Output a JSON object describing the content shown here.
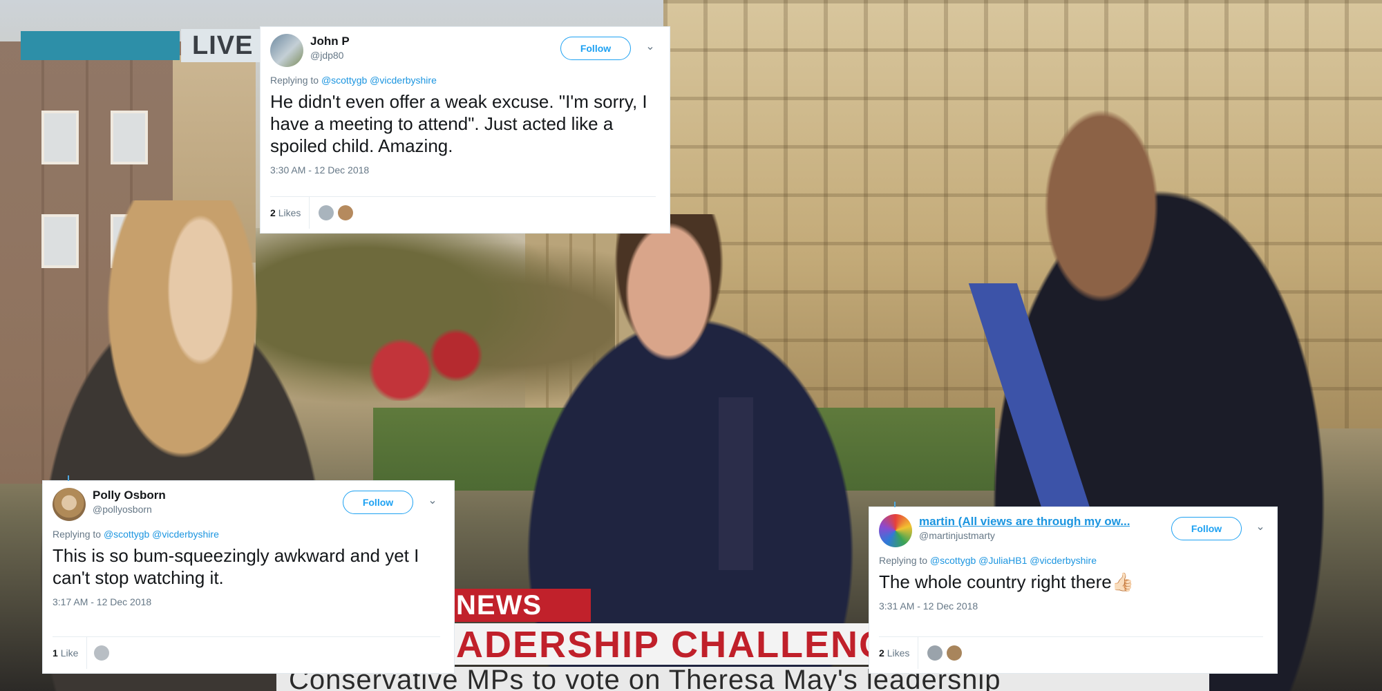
{
  "broadcast": {
    "live_label": "LIVE",
    "channel_label": "NEWS",
    "headline": "ADERSHIP CHALLENG",
    "ticker": "Conservative MPs to vote on Theresa May's leadership"
  },
  "tweets": [
    {
      "name": "John P",
      "handle": "@jdp80",
      "follow_label": "Follow",
      "caret": "⌄",
      "reply_prefix": "Replying to",
      "reply_to": "@scottygb @vicderbyshire",
      "text": "He didn't even offer a weak excuse. \"I'm sorry, I have a meeting to attend\". Just acted like a spoiled child. Amazing.",
      "time": "3:30 AM - 12 Dec 2018",
      "likes_count": "2",
      "likes_label": "Likes"
    },
    {
      "name": "Polly Osborn",
      "handle": "@pollyosborn",
      "follow_label": "Follow",
      "caret": "⌄",
      "reply_prefix": "Replying to",
      "reply_to": "@scottygb @vicderbyshire",
      "text": "This is so bum-squeezingly awkward and yet I can't stop watching it.",
      "time": "3:17 AM - 12 Dec 2018",
      "likes_count": "1",
      "likes_label": "Like"
    },
    {
      "name": "martin (All views are through my ow...",
      "handle": "@martinjustmarty",
      "follow_label": "Follow",
      "caret": "⌄",
      "reply_prefix": "Replying to",
      "reply_to": "@scottygb @JuliaHB1 @vicderbyshire",
      "text": "The whole country right there👍🏻",
      "time": "3:31 AM - 12 Dec 2018",
      "likes_count": "2",
      "likes_label": "Likes"
    }
  ],
  "colors": {
    "twitter_blue": "#1da1f2",
    "link_blue": "#1b95e0",
    "muted_gray": "#657786",
    "news_red": "#c1212b"
  }
}
